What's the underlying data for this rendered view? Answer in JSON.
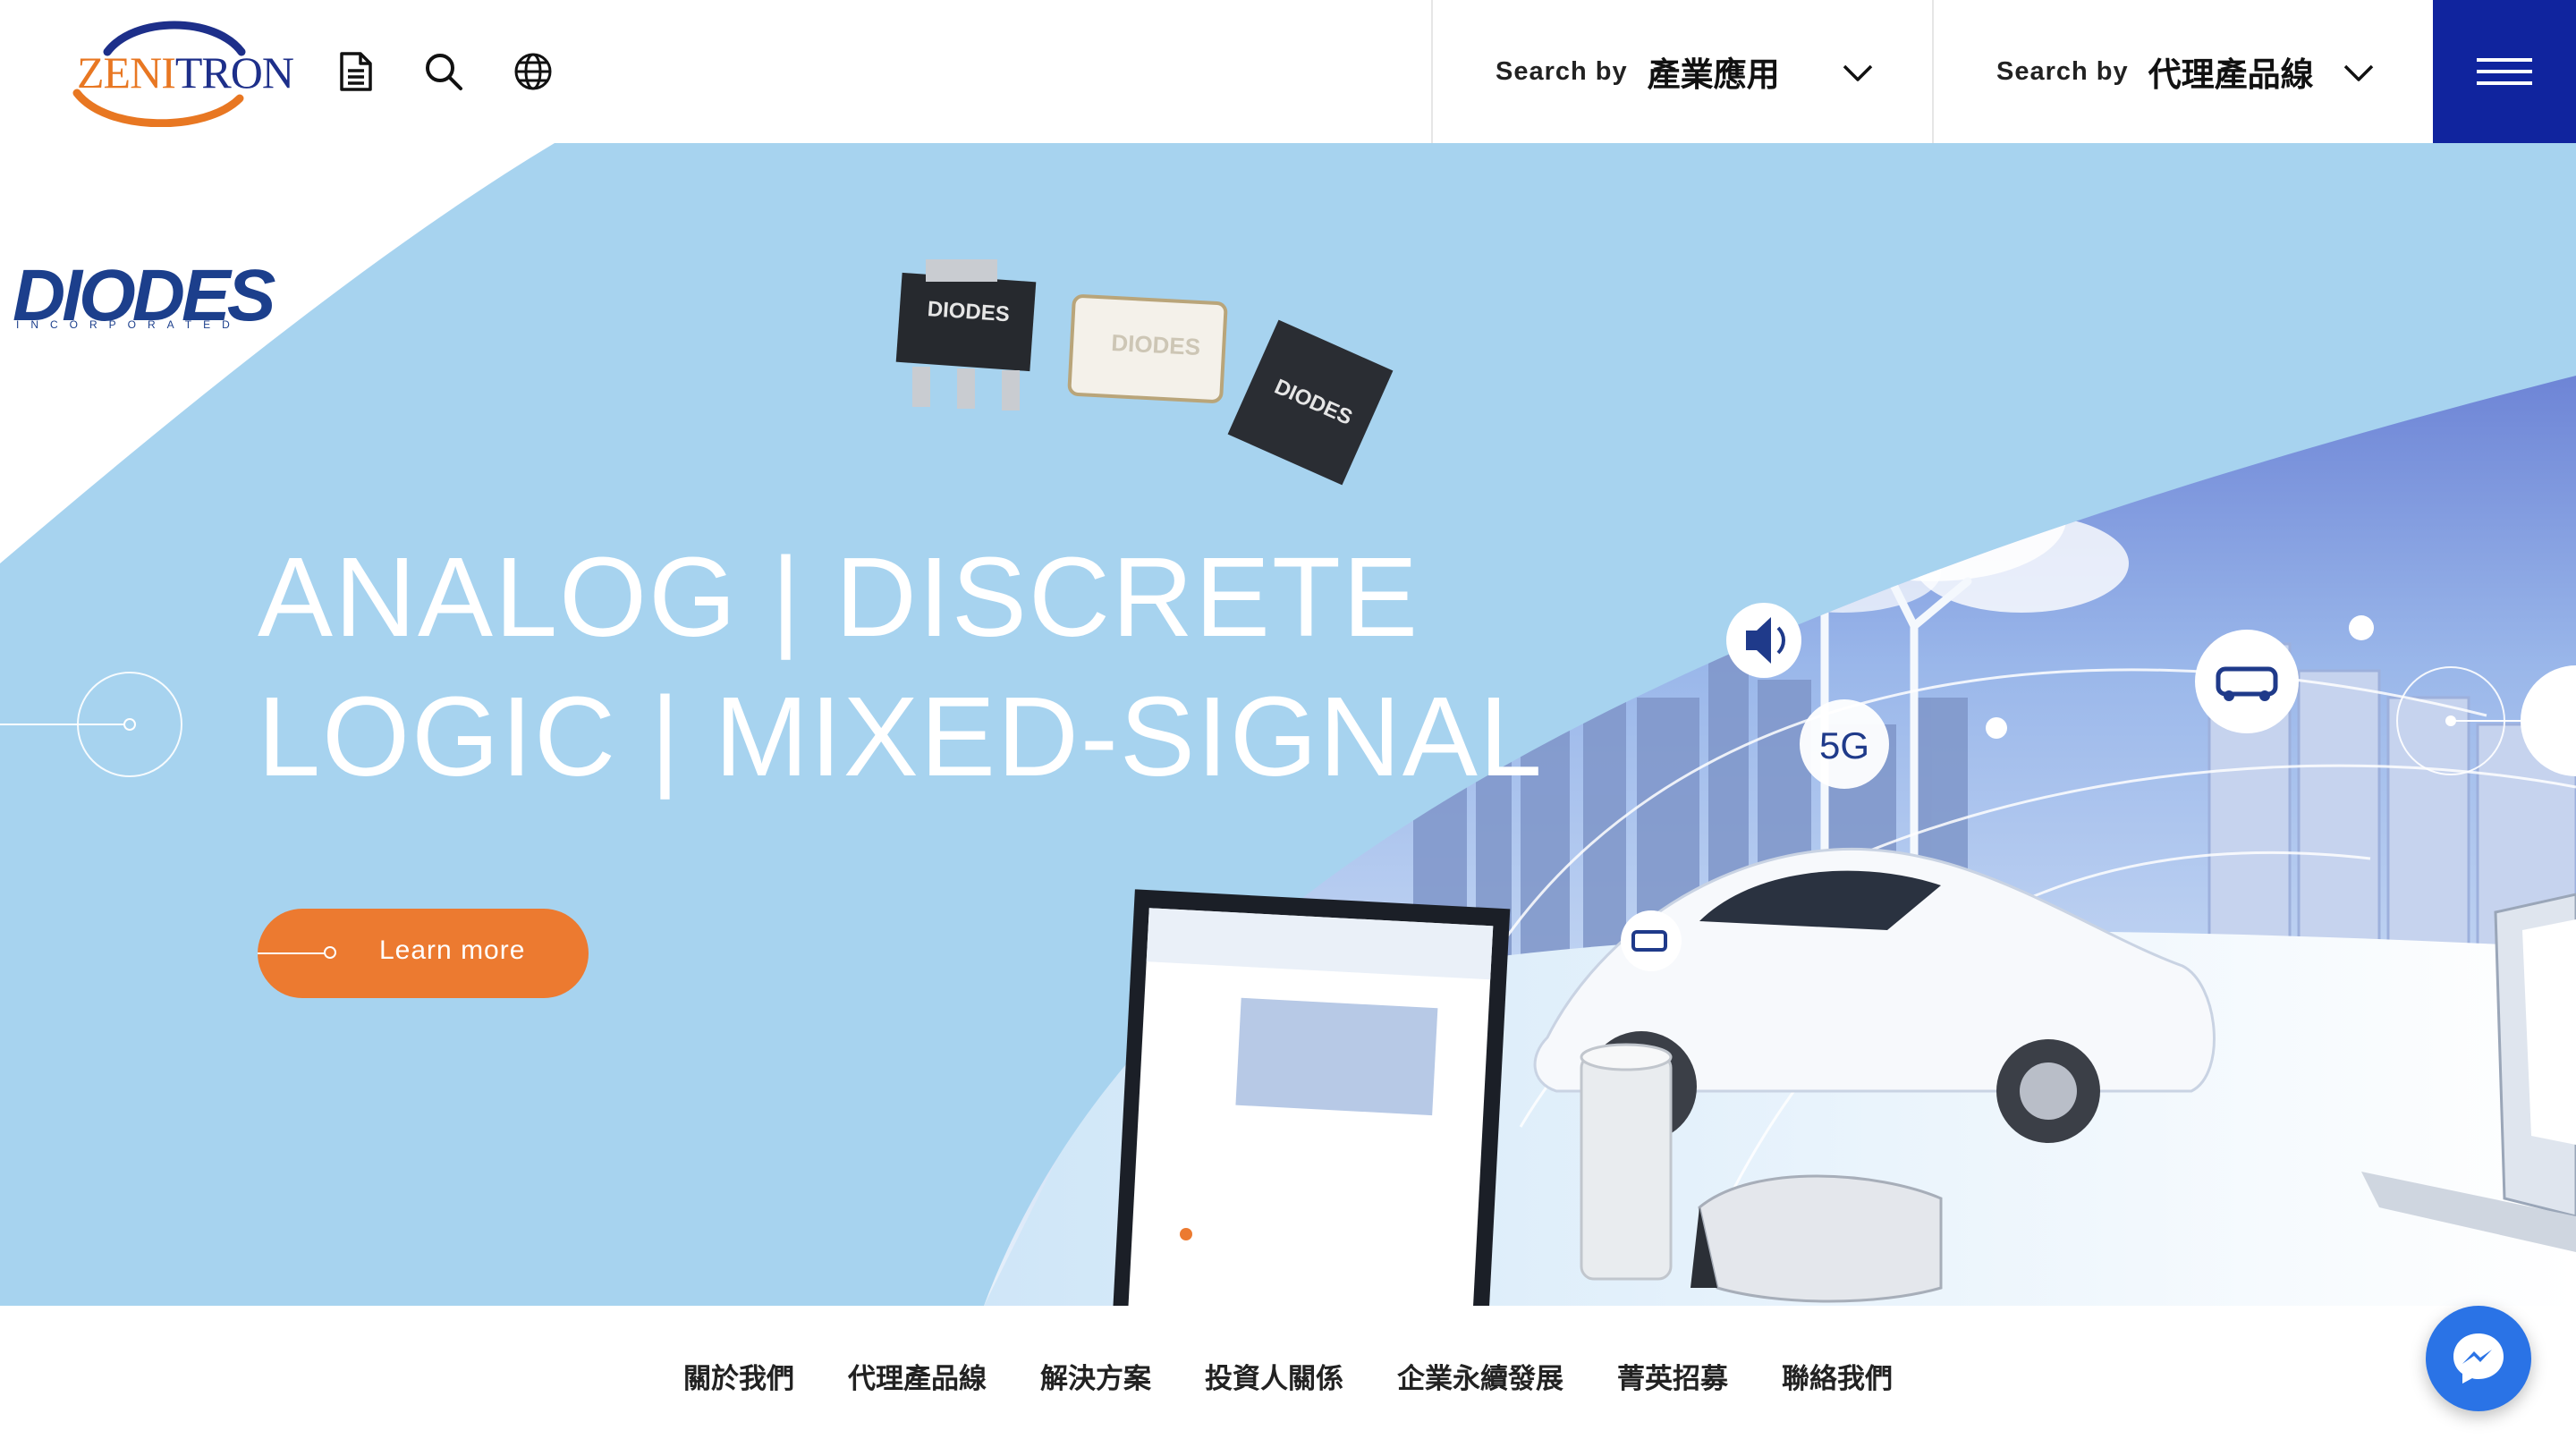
{
  "brand": {
    "logo_part1": "ZENI",
    "logo_part2": "TRON"
  },
  "header": {
    "icons": [
      "document-icon",
      "search-icon",
      "globe-icon"
    ],
    "search_industry": {
      "label": "Search by",
      "value": "產業應用"
    },
    "search_product": {
      "label": "Search by",
      "value": "代理產品線"
    },
    "menu_icon": "hamburger-menu-icon"
  },
  "hero": {
    "partner_logo": "DIODES",
    "partner_logo_sub": "INCORPORATED",
    "headline_line1": "ANALOG | DISCRETE",
    "headline_line2": "LOGIC | MIXED-SIGNAL",
    "cta_label": "Learn more",
    "network_badges": [
      "5G"
    ],
    "chip_marks": [
      "DIODES",
      "DIODES",
      "DIODES"
    ],
    "colors": {
      "sky": "#a7d3ef",
      "accent": "#ec7a30",
      "brand_blue": "#10249e"
    }
  },
  "footer_nav": {
    "items": [
      "關於我們",
      "代理產品線",
      "解決方案",
      "投資人關係",
      "企業永續發展",
      "菁英招募",
      "聯絡我們"
    ]
  },
  "chat": {
    "icon": "messenger-icon"
  }
}
